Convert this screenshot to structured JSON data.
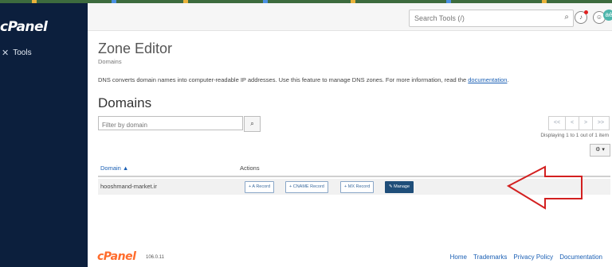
{
  "sidebar": {
    "logo": "cPanel",
    "tools_label": "Tools"
  },
  "header": {
    "search_placeholder": "Search Tools (/)",
    "user_badge": "aé"
  },
  "page": {
    "title": "Zone Editor",
    "breadcrumb": "Domains",
    "description": "DNS converts domain names into computer-readable IP addresses. Use this feature to manage DNS zones. For more information, read the",
    "description_link": "documentation",
    "description_end": ".",
    "section_title": "Domains"
  },
  "filter": {
    "placeholder": "Filter by domain"
  },
  "pagination": {
    "first": "<<",
    "prev": "<",
    "next": ">",
    "last": ">>",
    "info": "Displaying 1 to 1 out of 1 item"
  },
  "table": {
    "columns": [
      "Domain",
      "Actions"
    ],
    "rows": [
      {
        "domain": "hooshmand-market.ir",
        "buttons": {
          "a_record": "+ A Record",
          "cname_record": "+ CNAME Record",
          "mx_record": "+ MX Record",
          "manage": "Manage"
        }
      }
    ]
  },
  "footer": {
    "logo": "cPanel",
    "version": "106.0.11",
    "links": [
      "Home",
      "Trademarks",
      "Privacy Policy",
      "Documentation"
    ]
  },
  "colors": {
    "sidebar_bg": "#0c1f3d",
    "manage_button": "#1f4e79",
    "accent_link": "#1a5fb4",
    "arrow": "#d32020",
    "footer_logo": "#ff6c2c"
  },
  "icons": {
    "tools": "tools-icon",
    "search": "search-icon",
    "notifications": "bell-icon",
    "user": "user-icon",
    "settings": "gear-icon",
    "manage": "wrench-icon"
  }
}
